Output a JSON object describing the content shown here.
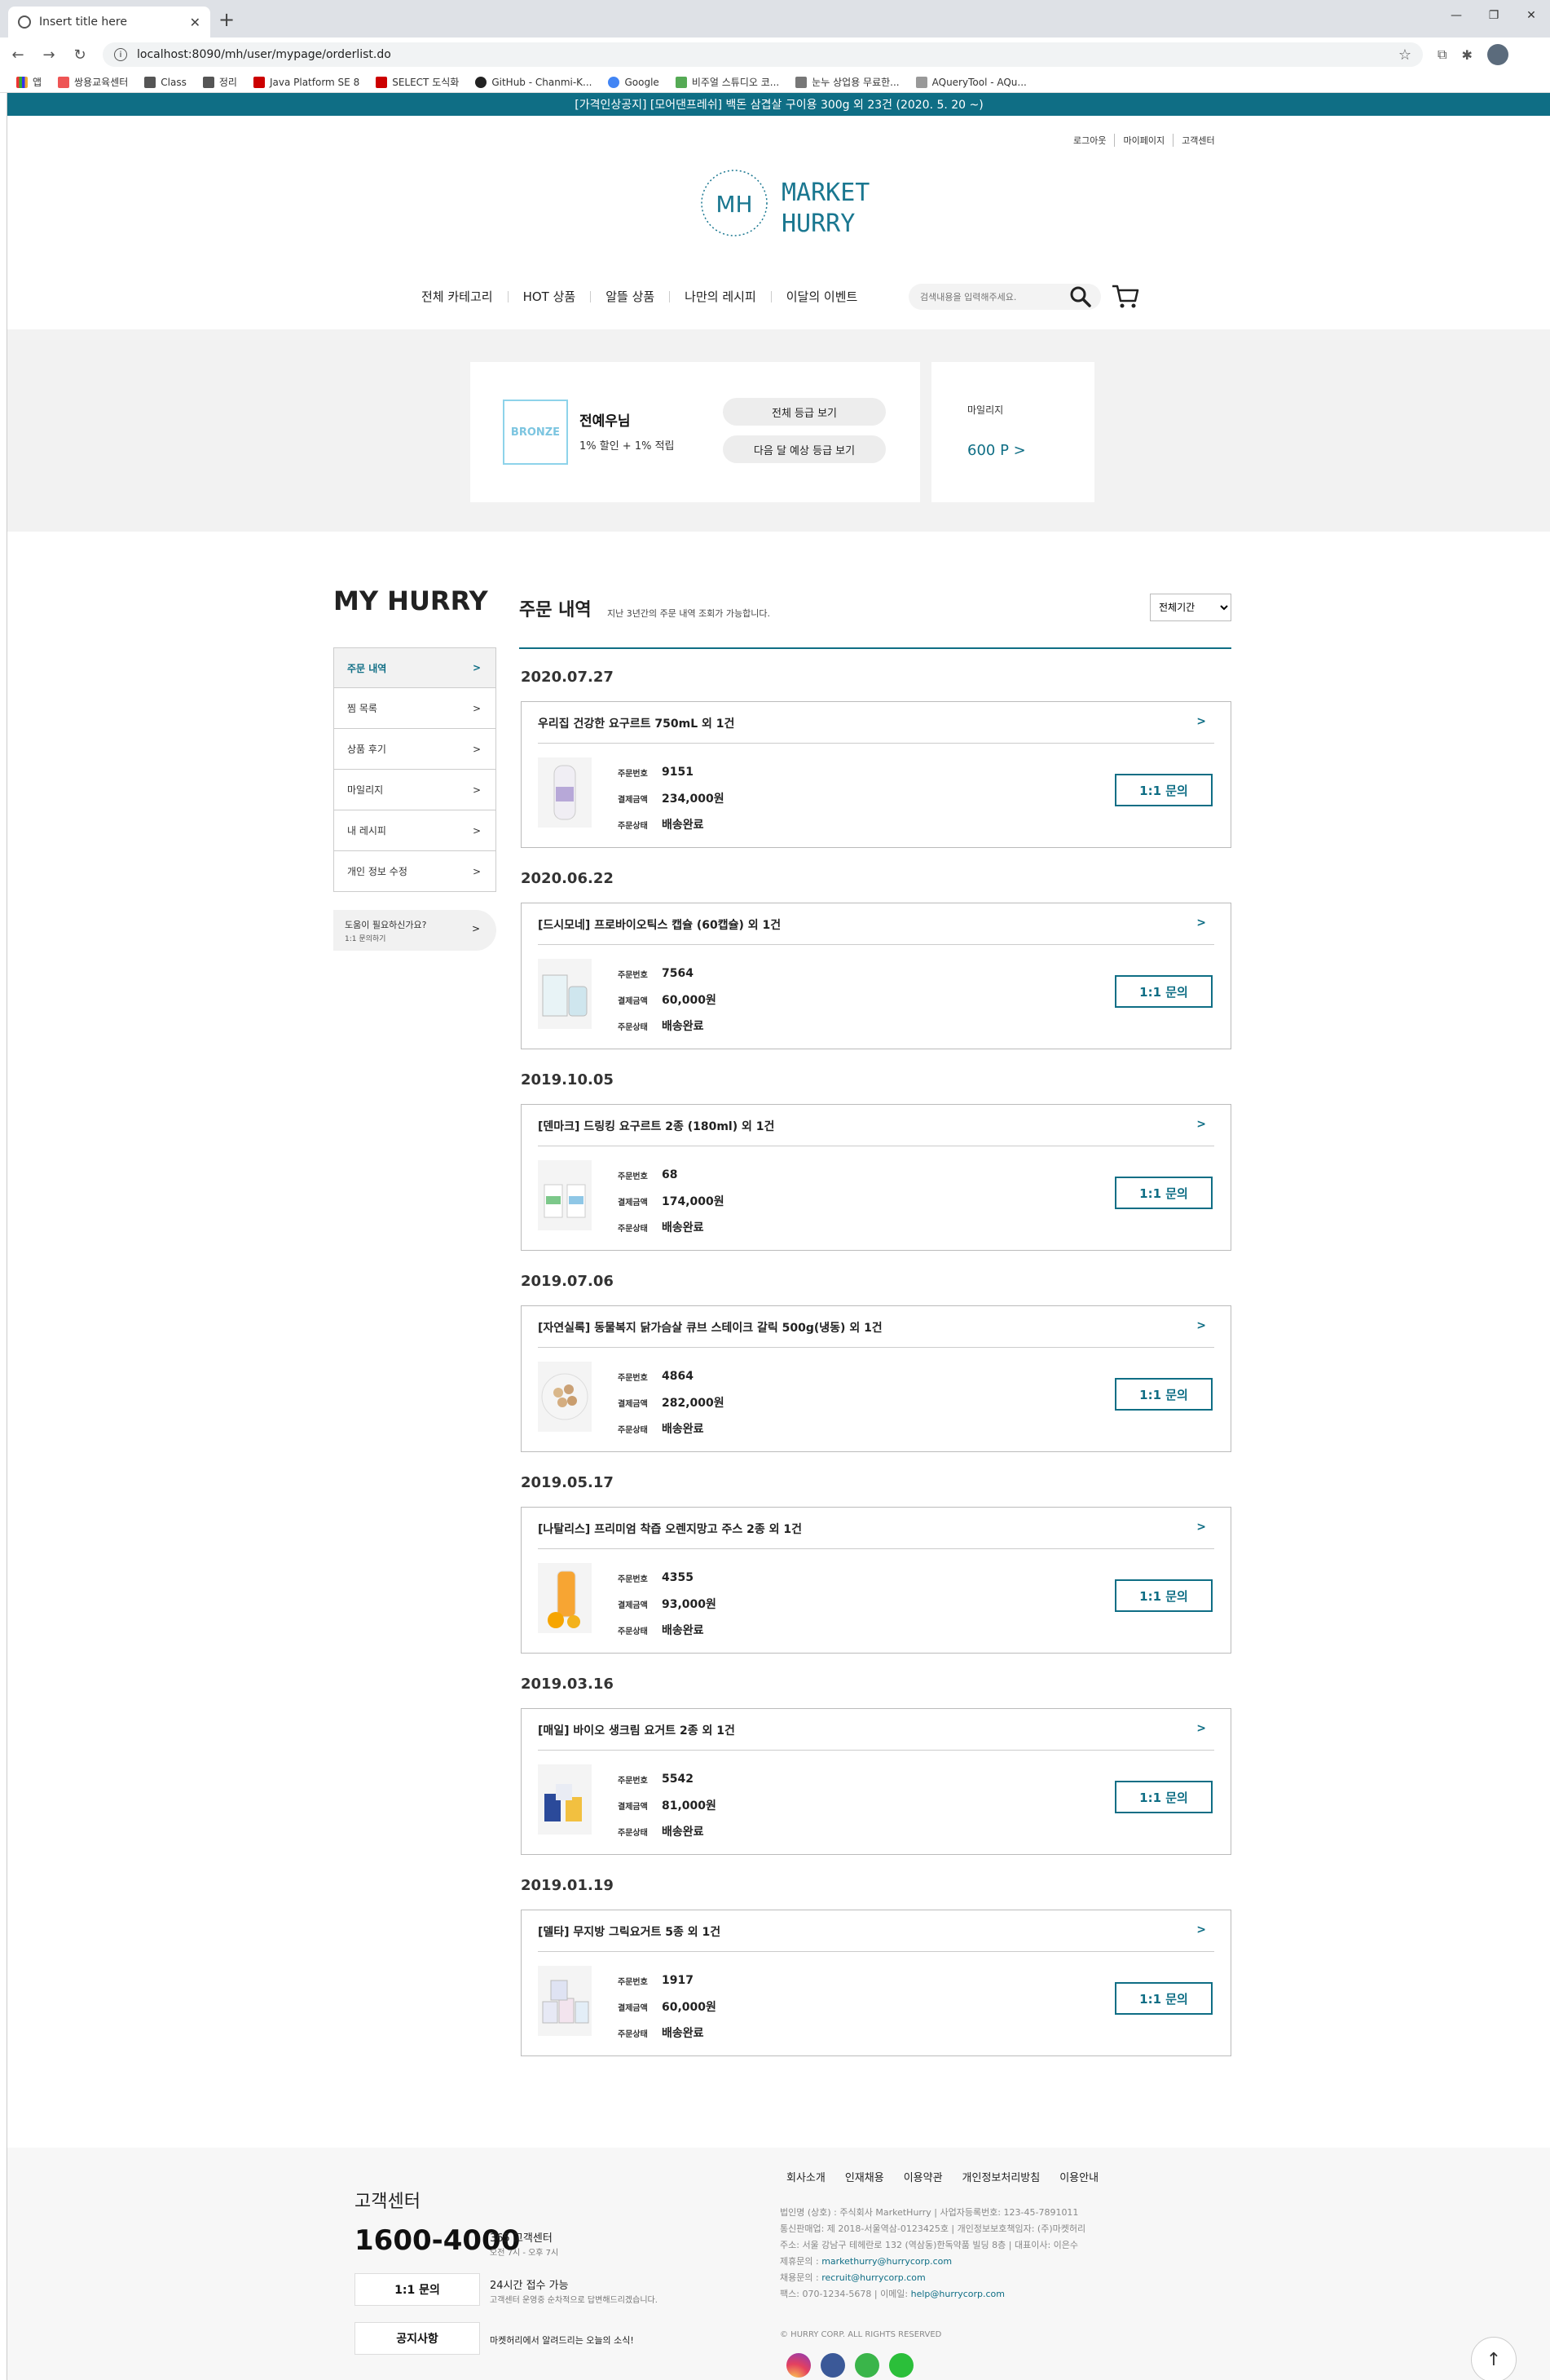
{
  "browser": {
    "tab_title": "Insert title here",
    "url": "localhost:8090/mh/user/mypage/orderlist.do",
    "bookmarks": [
      "앱",
      "쌍용교육센터",
      "Class",
      "정리",
      "Java Platform SE 8",
      "SELECT 도식화",
      "GitHub - Chanmi-K...",
      "Google",
      "비주얼 스튜디오 코...",
      "눈누 상업용 무료한...",
      "AQueryTool - AQu..."
    ]
  },
  "notice": "[가격인상공지] [모어댄프레쉬] 백돈 삼겹살 구이용 300g 외 23건 (2020. 5. 20 ~)",
  "util": [
    "로그아웃",
    "마이페이지",
    "고객센터"
  ],
  "logo": {
    "mark": "MH",
    "line1": "MARKET",
    "line2": "HURRY"
  },
  "gnb": [
    "전체 카테고리",
    "HOT 상품",
    "알뜰 상품",
    "나만의 레시피",
    "이달의 이벤트"
  ],
  "search": {
    "placeholder": "검색내용을 입력해주세요."
  },
  "grade": {
    "badge": "BRONZE",
    "name": "전예우님",
    "benefit": "1% 할인 + 1% 적립",
    "btn_all": "전체 등급 보기",
    "btn_next": "다음 달 예상 등급 보기",
    "mileage_label": "마일리지",
    "mileage_value": "600 P >"
  },
  "sidebar": {
    "title": "MY HURRY",
    "items": [
      "주문 내역",
      "찜 목록",
      "상품 후기",
      "마일리지",
      "내 레시피",
      "개인 정보 수정"
    ],
    "arrow": ">",
    "help_title": "도움이 필요하신가요?",
    "help_sub": "1:1 문의하기"
  },
  "content": {
    "title": "주문 내역",
    "subtitle": "지난 3년간의 주문 내역 조회가 가능합니다.",
    "period": "전체기간"
  },
  "labels": {
    "order_no": "주문번호",
    "amount": "결제금액",
    "status": "주문상태",
    "inquiry": "1:1 문의",
    "arrow": ">"
  },
  "orders": [
    {
      "date": "2020.07.27",
      "name": "우리집 건강한 요구르트 750mL 외 1건",
      "no": "9151",
      "amount": "234,000원",
      "status": "배송완료",
      "thumb": "yogurt-bottle"
    },
    {
      "date": "2020.06.22",
      "name": "[드시모네] 프로바이오틱스 캡슐 (60캡슐) 외 1건",
      "no": "7564",
      "amount": "60,000원",
      "status": "배송완료",
      "thumb": "capsule-box"
    },
    {
      "date": "2019.10.05",
      "name": "[덴마크] 드링킹 요구르트 2종 (180ml) 외 1건",
      "no": "68",
      "amount": "174,000원",
      "status": "배송완료",
      "thumb": "drink-cartons"
    },
    {
      "date": "2019.07.06",
      "name": "[자연실록] 동물복지 닭가슴살 큐브 스테이크 갈릭 500g(냉동) 외 1건",
      "no": "4864",
      "amount": "282,000원",
      "status": "배송완료",
      "thumb": "chicken-cubes"
    },
    {
      "date": "2019.05.17",
      "name": "[나탈리스] 프리미엄 착즙 오렌지망고 주스 2종 외 1건",
      "no": "4355",
      "amount": "93,000원",
      "status": "배송완료",
      "thumb": "orange-juice"
    },
    {
      "date": "2019.03.16",
      "name": "[매일] 바이오 생크림 요거트 2종 외 1건",
      "no": "5542",
      "amount": "81,000원",
      "status": "배송완료",
      "thumb": "yogurt-cups"
    },
    {
      "date": "2019.01.19",
      "name": "[델타] 무지방 그릭요거트 5종 외 1건",
      "no": "1917",
      "amount": "60,000원",
      "status": "배송완료",
      "thumb": "greek-yogurt"
    }
  ],
  "footer": {
    "cs_title": "고객센터",
    "phone": "1600-4000",
    "cs_365": "365 고객센터",
    "cs_hours": "오전 7시 - 오후 7시",
    "btn_inquiry": "1:1 문의",
    "inquiry_t1": "24시간 접수 가능",
    "inquiry_t2": "고객센터 운영중 순차적으로 답변해드리겠습니다.",
    "btn_notice": "공지사항",
    "notice_t": "마켓허리에서 알려드리는 오늘의 소식!",
    "links": [
      "회사소개",
      "인재채용",
      "이용약관",
      "개인정보처리방침",
      "이용안내"
    ],
    "info1": "법인명 (상호) : 주식회사 MarketHurry  |  사업자등록번호: 123-45-7891011",
    "info2": "통신판매업: 제 2018-서울역삼-0123425호  |  개인정보보호책임자: (주)마켓허리",
    "info3": "주소: 서울 강남구 테헤란로 132 (역삼동)한독약품 빌딩 8층  |  대표이사: 이은수",
    "info4_label": "제휴문의 : ",
    "info4_value": "markethurry@hurrycorp.com",
    "info5_label": "채용문의 : ",
    "info5_value": "recruit@hurrycorp.com",
    "info6_label": "팩스: 070-1234-5678  |  이메일: ",
    "info6_value": "help@hurrycorp.com",
    "copyright": "© HURRY CORP. ALL RIGHTS RESERVED",
    "social": [
      "instagram-icon",
      "facebook-icon",
      "kakao-icon",
      "line-icon"
    ]
  }
}
